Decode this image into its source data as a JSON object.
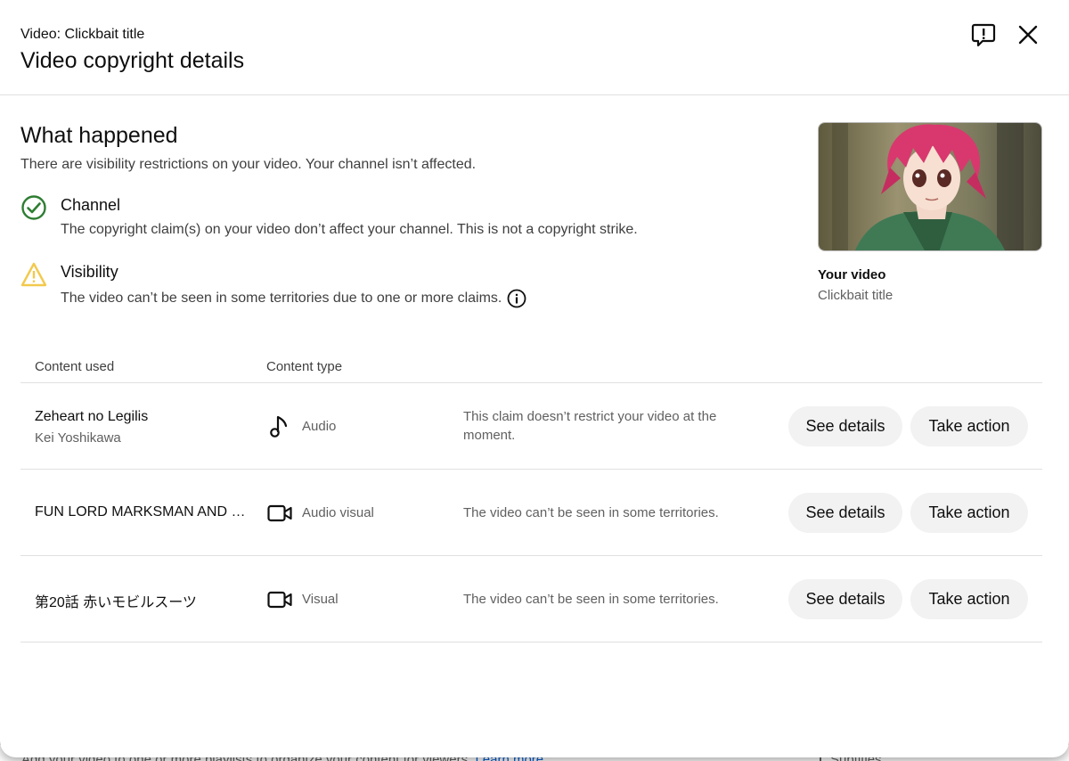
{
  "background": {
    "text": "Add your video to one or more playlists to organize your content for viewers.",
    "link": "Learn more",
    "right": "Subtitles"
  },
  "header": {
    "subtitle": "Video: Clickbait title",
    "title": "Video copyright details",
    "feedback_icon": "feedback-icon",
    "close_icon": "close-icon"
  },
  "summary": {
    "heading": "What happened",
    "description": "There are visibility restrictions on your video. Your channel isn’t affected.",
    "channel": {
      "title": "Channel",
      "description": "The copyright claim(s) on your video don’t affect your channel. This is not a copyright strike.",
      "icon": "check-circle-icon",
      "color": "#2e7d32"
    },
    "visibility": {
      "title": "Visibility",
      "description": "The video can’t be seen in some territories due to one or more claims.",
      "icon": "warning-icon",
      "color": "#f2c94c"
    }
  },
  "video": {
    "label": "Your video",
    "title": "Clickbait title"
  },
  "table": {
    "headers": {
      "content_used": "Content used",
      "content_type": "Content type"
    },
    "rows": [
      {
        "title": "Zeheart no Legilis",
        "subtitle": "Kei Yoshikawa",
        "type": "Audio",
        "type_icon": "music-note-icon",
        "description": "This claim doesn’t restrict your video at the moment.",
        "details_label": "See details",
        "action_label": "Take action"
      },
      {
        "title": "FUN LORD MARKSMAN AND V...",
        "subtitle": "",
        "type": "Audio visual",
        "type_icon": "video-camera-icon",
        "description": "The video can’t be seen in some territories.",
        "details_label": "See details",
        "action_label": "Take action"
      },
      {
        "title": "第20話 赤いモビルスーツ",
        "subtitle": "",
        "type": "Visual",
        "type_icon": "video-camera-icon",
        "description": "The video can’t be seen in some territories.",
        "details_label": "See details",
        "action_label": "Take action"
      }
    ]
  }
}
